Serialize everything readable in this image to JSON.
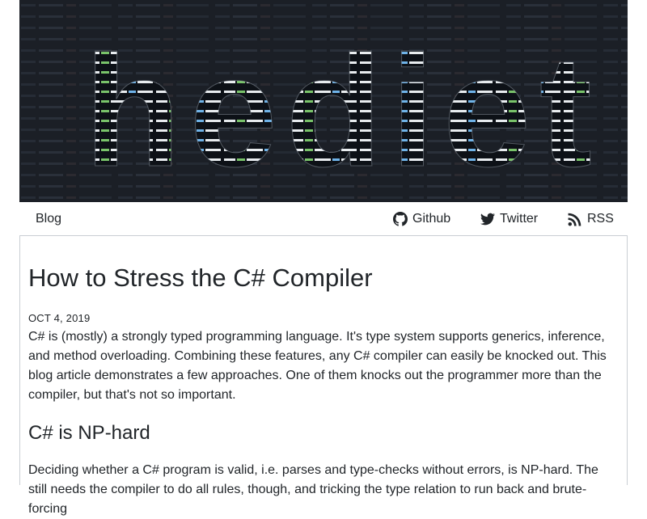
{
  "banner": {
    "logo_text": "hediet",
    "code_snippet": "mode,r)) return=e.get(n)||null,\"=\"==typeof ifcount!==!0)&& n(c5,a=e.get(r)&&key)||r=null;for(f,0,v,u[v],1)&&(d&&e.then(n.key===0;i++){switch(r.type){case return n.K;function(r,u){var o=null;if(\"string\"==typeof e&&(n=e.get(r))){for(var o=e.altertaker(o)&&r.type===i.type)}"
  },
  "nav": {
    "blog": "Blog",
    "github": "Github",
    "twitter": "Twitter",
    "rss": "RSS"
  },
  "post": {
    "title": "How to Stress the C# Compiler",
    "date": "OCT 4, 2019",
    "intro": "C# is (mostly) a strongly typed programming language. It's type system supports generics, inference, and method overloading. Combining these features, any C# compiler can easily be knocked out. This blog article demonstrates a few approaches. One of them knocks out the programmer more than the compiler, but that's not so important.",
    "section_heading": "C# is NP-hard",
    "section_text": "Deciding whether a C# program is valid, i.e. parses and type-checks without errors, is NP-hard. The still needs the compiler to do all rules, though, and tricking the type relation to run back and brute-forcing"
  },
  "colors": {
    "banner_bg": "#1b1f26",
    "code_green": "#79c36a",
    "code_blue": "#6fb3e8",
    "code_white": "#e8ecef",
    "border": "#c9ced3",
    "text": "#212529"
  }
}
